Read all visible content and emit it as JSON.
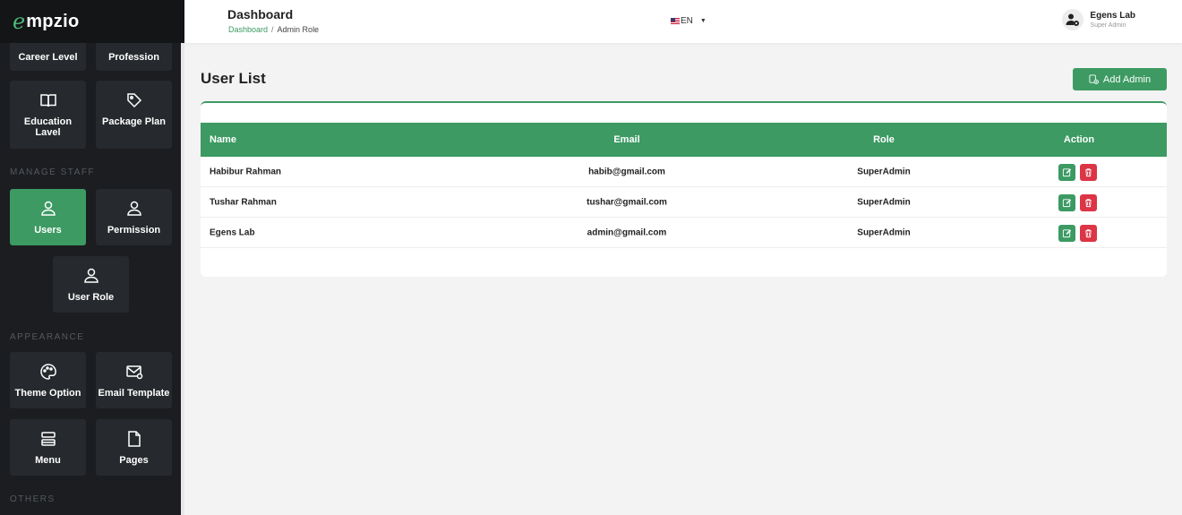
{
  "brand": {
    "mark": "e",
    "name": "mpzio"
  },
  "sidebar": {
    "top_row": [
      {
        "label": "Career Level"
      },
      {
        "label": "Profession"
      }
    ],
    "tiles_1": [
      {
        "label": "Education Lavel",
        "icon": "book-icon"
      },
      {
        "label": "Package Plan",
        "icon": "tag-icon"
      }
    ],
    "manage_staff_label": "MANAGE STAFF",
    "staff": [
      {
        "label": "Users",
        "icon": "user-icon",
        "active": true
      },
      {
        "label": "Permission",
        "icon": "user-icon"
      },
      {
        "label": "User Role",
        "icon": "user-icon"
      }
    ],
    "appearance_label": "APPEARANCE",
    "appearance": [
      {
        "label": "Theme Option",
        "icon": "palette-icon"
      },
      {
        "label": "Email Template",
        "icon": "mail-icon"
      },
      {
        "label": "Menu",
        "icon": "menu-icon"
      },
      {
        "label": "Pages",
        "icon": "page-icon"
      }
    ],
    "others_label": "OTHERS"
  },
  "topbar": {
    "title": "Dashboard",
    "breadcrumb": {
      "home": "Dashboard",
      "separator": "/",
      "current": "Admin Role"
    },
    "language": "EN",
    "user": {
      "name": "Egens Lab",
      "role": "Super Admin"
    }
  },
  "main": {
    "title": "User List",
    "add_button": "Add Admin",
    "table": {
      "headers": {
        "name": "Name",
        "email": "Email",
        "role": "Role",
        "action": "Action"
      },
      "rows": [
        {
          "name": "Habibur Rahman",
          "email": "habib@gmail.com",
          "role": "SuperAdmin"
        },
        {
          "name": "Tushar Rahman",
          "email": "tushar@gmail.com",
          "role": "SuperAdmin"
        },
        {
          "name": "Egens Lab",
          "email": "admin@gmail.com",
          "role": "SuperAdmin"
        }
      ]
    }
  },
  "colors": {
    "accent": "#3c9a62",
    "danger": "#dc3545",
    "sidebar_bg": "#1b1d20",
    "tile_bg": "#26292d"
  }
}
